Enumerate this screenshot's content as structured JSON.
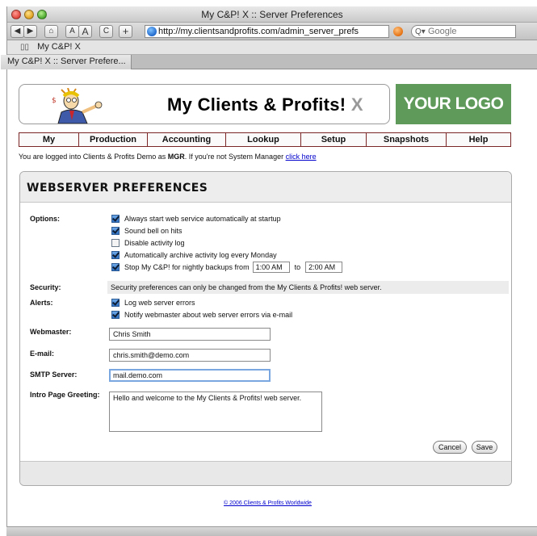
{
  "window": {
    "title": "My C&P! X :: Server Preferences"
  },
  "toolbar": {
    "back": "◀",
    "forward": "▶",
    "home": "⌂",
    "text_smaller": "A",
    "text_larger": "A",
    "reload": "C",
    "add": "+",
    "url": "http://my.clientsandprofits.com/admin_server_prefs",
    "search_placeholder": "Google"
  },
  "bookmarks": {
    "item": "My C&P! X"
  },
  "tabs": {
    "active": "My C&P! X :: Server Prefere..."
  },
  "header": {
    "brand": "My Clients & Profits!",
    "brand_suffix": "X",
    "logo_text": "YOUR LOGO HERE"
  },
  "nav": {
    "items": [
      "My",
      "Production",
      "Accounting",
      "Lookup",
      "Setup",
      "Snapshots",
      "Help"
    ]
  },
  "login": {
    "prefix": "You are logged into Clients & Profits Demo as",
    "user": "MGR",
    "middle": ". If you're not System Manager",
    "link": "click here"
  },
  "panel": {
    "title": "WEBSERVER PREFERENCES",
    "labels": {
      "options": "Options:",
      "security": "Security:",
      "alerts": "Alerts:",
      "webmaster": "Webmaster:",
      "email": "E-mail:",
      "smtp": "SMTP Server:",
      "greeting": "Intro Page Greeting:"
    },
    "options": [
      {
        "label": "Always start web service automatically at startup",
        "checked": true
      },
      {
        "label": "Sound bell on hits",
        "checked": true
      },
      {
        "label": "Disable activity log",
        "checked": false
      },
      {
        "label": "Automatically archive activity log every Monday",
        "checked": true
      },
      {
        "label": "Stop My C&P! for nightly backups from",
        "checked": true
      }
    ],
    "backup_from": "1:00 AM",
    "backup_to_label": "to",
    "backup_to": "2:00 AM",
    "security_text": "Security preferences can only be changed from the My Clients & Profits! web server.",
    "alerts": [
      {
        "label": "Log web server errors",
        "checked": true
      },
      {
        "label": "Notify webmaster about web server errors via e-mail",
        "checked": true
      }
    ],
    "webmaster": "Chris Smith",
    "email": "chris.smith@demo.com",
    "smtp": "mail.demo.com",
    "greeting": "Hello and welcome to the My Clients & Profits! web server.",
    "cancel_label": "Cancel",
    "save_label": "Save"
  },
  "footer": {
    "copyright": "© 2006 Clients & Profits Worldwide"
  }
}
